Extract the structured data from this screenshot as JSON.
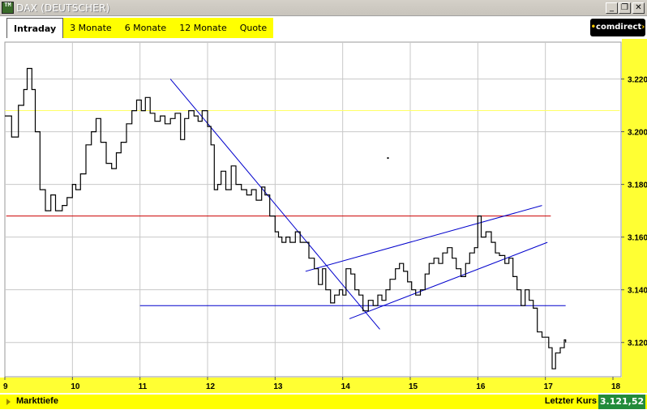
{
  "window": {
    "title": "DAX (DEUTSCHER)",
    "app_icon": "TM",
    "controls": {
      "minimize": "_",
      "restore": "❐",
      "close": "✕"
    }
  },
  "tabs": [
    {
      "label": "Intraday",
      "active": true
    },
    {
      "label": "3 Monate",
      "active": false
    },
    {
      "label": "6 Monate",
      "active": false
    },
    {
      "label": "12 Monate",
      "active": false
    },
    {
      "label": "Quote",
      "active": false
    }
  ],
  "brand": {
    "text": "comdirect"
  },
  "bottom": {
    "depth_label": "Markttiefe",
    "last_label": "Letzter Kurs",
    "last_value": "3.121,52"
  },
  "colors": {
    "tab_bar": "#ffff00",
    "price_line": "#000000",
    "trend_lines": "#0000cc",
    "resistance_line": "#cc0000",
    "reference_line": "#ffff66",
    "grid": "#c8c8c8",
    "last_value_bg": "#228b3a"
  },
  "chart_data": {
    "type": "line",
    "title": "",
    "xlabel": "",
    "ylabel": "",
    "x_ticks": [
      "9",
      "10",
      "11",
      "12",
      "13",
      "14",
      "15",
      "16",
      "17",
      "18"
    ],
    "y_ticks": [
      "3.120",
      "3.140",
      "3.160",
      "3.180",
      "3.200",
      "3.220"
    ],
    "xlim": [
      9,
      18
    ],
    "ylim": [
      3.107,
      3.234
    ],
    "grid": true,
    "step": true,
    "series": [
      {
        "values": [
          [
            9.0,
            3.206
          ],
          [
            9.1,
            3.198
          ],
          [
            9.2,
            3.21
          ],
          [
            9.28,
            3.216
          ],
          [
            9.33,
            3.224
          ],
          [
            9.4,
            3.216
          ],
          [
            9.45,
            3.2
          ],
          [
            9.52,
            3.178
          ],
          [
            9.6,
            3.17
          ],
          [
            9.68,
            3.176
          ],
          [
            9.75,
            3.17
          ],
          [
            9.85,
            3.172
          ],
          [
            9.92,
            3.175
          ],
          [
            10.0,
            3.18
          ],
          [
            10.05,
            3.178
          ],
          [
            10.12,
            3.184
          ],
          [
            10.2,
            3.195
          ],
          [
            10.28,
            3.2
          ],
          [
            10.35,
            3.205
          ],
          [
            10.42,
            3.196
          ],
          [
            10.5,
            3.188
          ],
          [
            10.58,
            3.186
          ],
          [
            10.65,
            3.192
          ],
          [
            10.72,
            3.196
          ],
          [
            10.8,
            3.203
          ],
          [
            10.88,
            3.208
          ],
          [
            10.95,
            3.212
          ],
          [
            11.02,
            3.208
          ],
          [
            11.08,
            3.213
          ],
          [
            11.15,
            3.207
          ],
          [
            11.22,
            3.204
          ],
          [
            11.3,
            3.206
          ],
          [
            11.37,
            3.203
          ],
          [
            11.45,
            3.205
          ],
          [
            11.52,
            3.207
          ],
          [
            11.6,
            3.197
          ],
          [
            11.66,
            3.205
          ],
          [
            11.72,
            3.208
          ],
          [
            11.8,
            3.206
          ],
          [
            11.86,
            3.204
          ],
          [
            11.92,
            3.208
          ],
          [
            12.0,
            3.202
          ],
          [
            12.05,
            3.195
          ],
          [
            12.1,
            3.178
          ],
          [
            12.15,
            3.18
          ],
          [
            12.2,
            3.185
          ],
          [
            12.27,
            3.178
          ],
          [
            12.35,
            3.187
          ],
          [
            12.42,
            3.18
          ],
          [
            12.5,
            3.178
          ],
          [
            12.58,
            3.176
          ],
          [
            12.65,
            3.178
          ],
          [
            12.72,
            3.174
          ],
          [
            12.8,
            3.179
          ],
          [
            12.85,
            3.176
          ],
          [
            12.92,
            3.168
          ],
          [
            13.0,
            3.162
          ],
          [
            13.05,
            3.16
          ],
          [
            13.1,
            3.158
          ],
          [
            13.16,
            3.16
          ],
          [
            13.22,
            3.158
          ],
          [
            13.3,
            3.162
          ],
          [
            13.37,
            3.158
          ],
          [
            13.42,
            3.158
          ],
          [
            13.5,
            3.152
          ],
          [
            13.58,
            3.148
          ],
          [
            13.64,
            3.142
          ],
          [
            13.7,
            3.148
          ],
          [
            13.75,
            3.14
          ],
          [
            13.82,
            3.135
          ],
          [
            13.88,
            3.138
          ],
          [
            13.95,
            3.14
          ],
          [
            14.0,
            3.138
          ],
          [
            14.05,
            3.148
          ],
          [
            14.12,
            3.146
          ],
          [
            14.18,
            3.14
          ],
          [
            14.24,
            3.138
          ],
          [
            14.3,
            3.132
          ],
          [
            14.38,
            3.136
          ],
          [
            14.45,
            3.134
          ],
          [
            14.52,
            3.138
          ],
          [
            14.58,
            3.136
          ],
          [
            14.64,
            3.14
          ],
          [
            14.7,
            3.144
          ],
          [
            14.78,
            3.148
          ],
          [
            14.84,
            3.15
          ],
          [
            14.9,
            3.147
          ],
          [
            14.96,
            3.143
          ],
          [
            15.02,
            3.14
          ],
          [
            15.08,
            3.138
          ],
          [
            15.15,
            3.14
          ],
          [
            15.22,
            3.146
          ],
          [
            15.28,
            3.15
          ],
          [
            15.35,
            3.152
          ],
          [
            15.42,
            3.15
          ],
          [
            15.48,
            3.154
          ],
          [
            15.55,
            3.156
          ],
          [
            15.62,
            3.152
          ],
          [
            15.68,
            3.148
          ],
          [
            15.75,
            3.145
          ],
          [
            15.82,
            3.15
          ],
          [
            15.88,
            3.154
          ],
          [
            15.95,
            3.156
          ],
          [
            16.0,
            3.168
          ],
          [
            16.05,
            3.16
          ],
          [
            16.12,
            3.162
          ],
          [
            16.2,
            3.158
          ],
          [
            16.26,
            3.154
          ],
          [
            16.32,
            3.153
          ],
          [
            16.4,
            3.15
          ],
          [
            16.46,
            3.152
          ],
          [
            16.52,
            3.145
          ],
          [
            16.58,
            3.14
          ],
          [
            16.64,
            3.134
          ],
          [
            16.7,
            3.14
          ],
          [
            16.76,
            3.136
          ],
          [
            16.82,
            3.133
          ],
          [
            16.88,
            3.124
          ],
          [
            16.95,
            3.122
          ],
          [
            17.0,
            3.122
          ],
          [
            17.05,
            3.118
          ],
          [
            17.1,
            3.11
          ],
          [
            17.15,
            3.116
          ],
          [
            17.22,
            3.118
          ],
          [
            17.28,
            3.121
          ],
          [
            17.3,
            3.12
          ]
        ]
      }
    ],
    "horizontal_lines": [
      {
        "y": 3.208,
        "from_x": 9.0,
        "to_x": 18.1,
        "color": "#ffff66"
      },
      {
        "y": 3.168,
        "from_x": 9.02,
        "to_x": 17.08,
        "color": "#cc0000"
      },
      {
        "y": 3.134,
        "from_x": 11.0,
        "to_x": 17.3,
        "color": "#0000cc"
      }
    ],
    "trend_lines": [
      {
        "from": [
          11.45,
          3.22
        ],
        "to": [
          14.55,
          3.125
        ]
      },
      {
        "from": [
          13.45,
          3.147
        ],
        "to": [
          16.95,
          3.172
        ]
      },
      {
        "from": [
          14.1,
          3.129
        ],
        "to": [
          17.03,
          3.158
        ]
      }
    ],
    "markers": [
      {
        "x": 14.67,
        "y": 3.19
      }
    ]
  }
}
